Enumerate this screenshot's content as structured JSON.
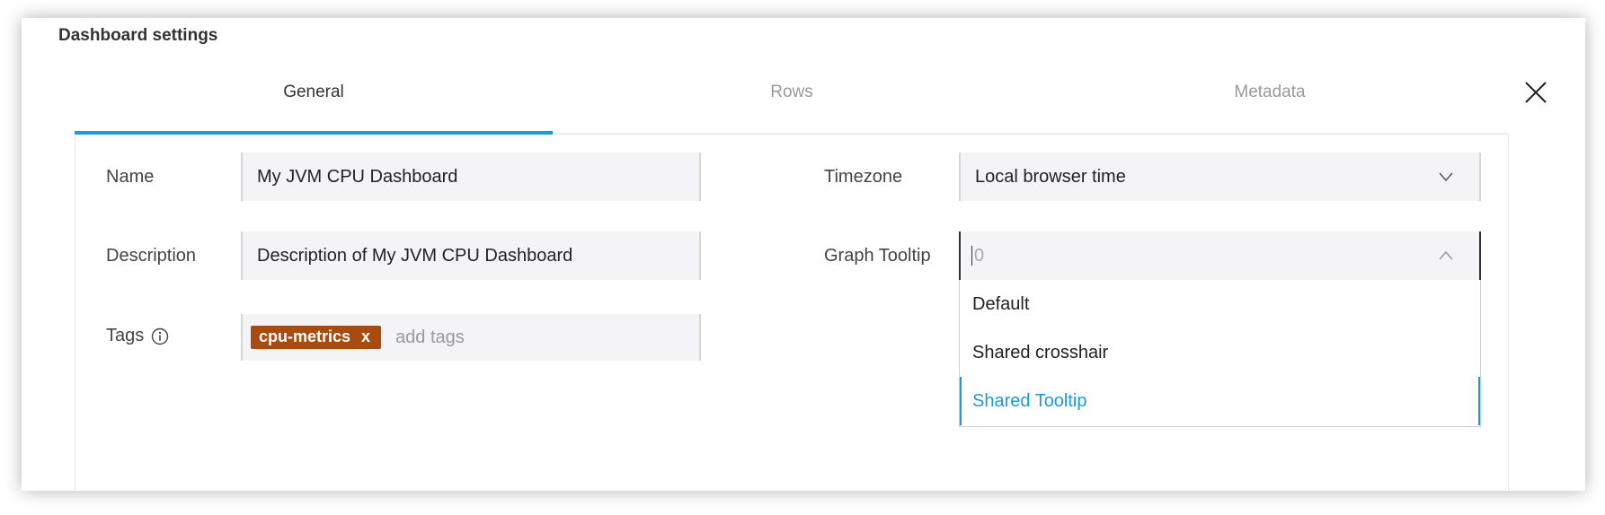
{
  "dialog": {
    "title": "Dashboard settings",
    "close_icon": "close-icon"
  },
  "tabs": [
    {
      "label": "General",
      "active": true
    },
    {
      "label": "Rows",
      "active": false
    },
    {
      "label": "Metadata",
      "active": false
    }
  ],
  "form": {
    "name_label": "Name",
    "name_value": "My JVM CPU Dashboard",
    "description_label": "Description",
    "description_value": "Description of My JVM CPU Dashboard",
    "tags_label": "Tags",
    "tags_info_icon": "info-icon",
    "tags": [
      {
        "label": "cpu-metrics",
        "remove": "x"
      }
    ],
    "tags_placeholder": "add tags",
    "timezone_label": "Timezone",
    "timezone_value": "Local browser time",
    "graph_tooltip_label": "Graph Tooltip",
    "graph_tooltip_value": "0",
    "graph_tooltip_options": [
      {
        "label": "Default",
        "selected": false
      },
      {
        "label": "Shared crosshair",
        "selected": false
      },
      {
        "label": "Shared Tooltip",
        "selected": true
      }
    ]
  },
  "colors": {
    "accent": "#1f9ad8",
    "tag_background": "#a94a0f",
    "field_background": "#f4f4f6"
  }
}
